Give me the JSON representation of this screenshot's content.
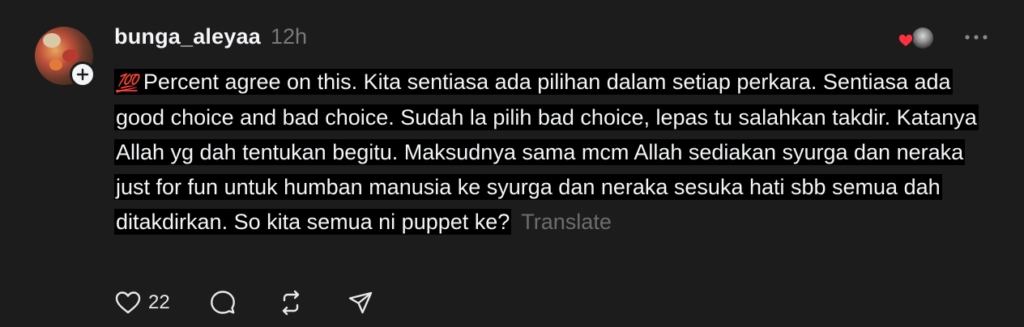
{
  "post": {
    "username": "bunga_aleyaa",
    "time": "12h",
    "emoji": "💯",
    "text": "Percent agree on this. Kita sentiasa ada pilihan dalam setiap perkara. Sentiasa ada good choice and bad choice. Sudah la pilih bad choice, lepas tu salahkan takdir. Katanya Allah yg dah tentukan begitu. Maksudnya sama mcm Allah sediakan syurga dan neraka just for fun untuk humban manusia ke syurga dan neraka sesuka hati sbb semua dah ditakdirkan. So kita semua ni puppet ke?",
    "translate_label": "Translate",
    "like_count": "22"
  },
  "icons": {
    "follow": "plus-icon",
    "more": "more-horizontal-icon",
    "like": "heart-icon",
    "comment": "comment-bubble-icon",
    "repost": "repost-icon",
    "share": "send-icon"
  },
  "colors": {
    "background": "#1c1c1c",
    "text": "#f3f5f7",
    "muted": "#7a7a7a",
    "heart": "#ff3040"
  }
}
